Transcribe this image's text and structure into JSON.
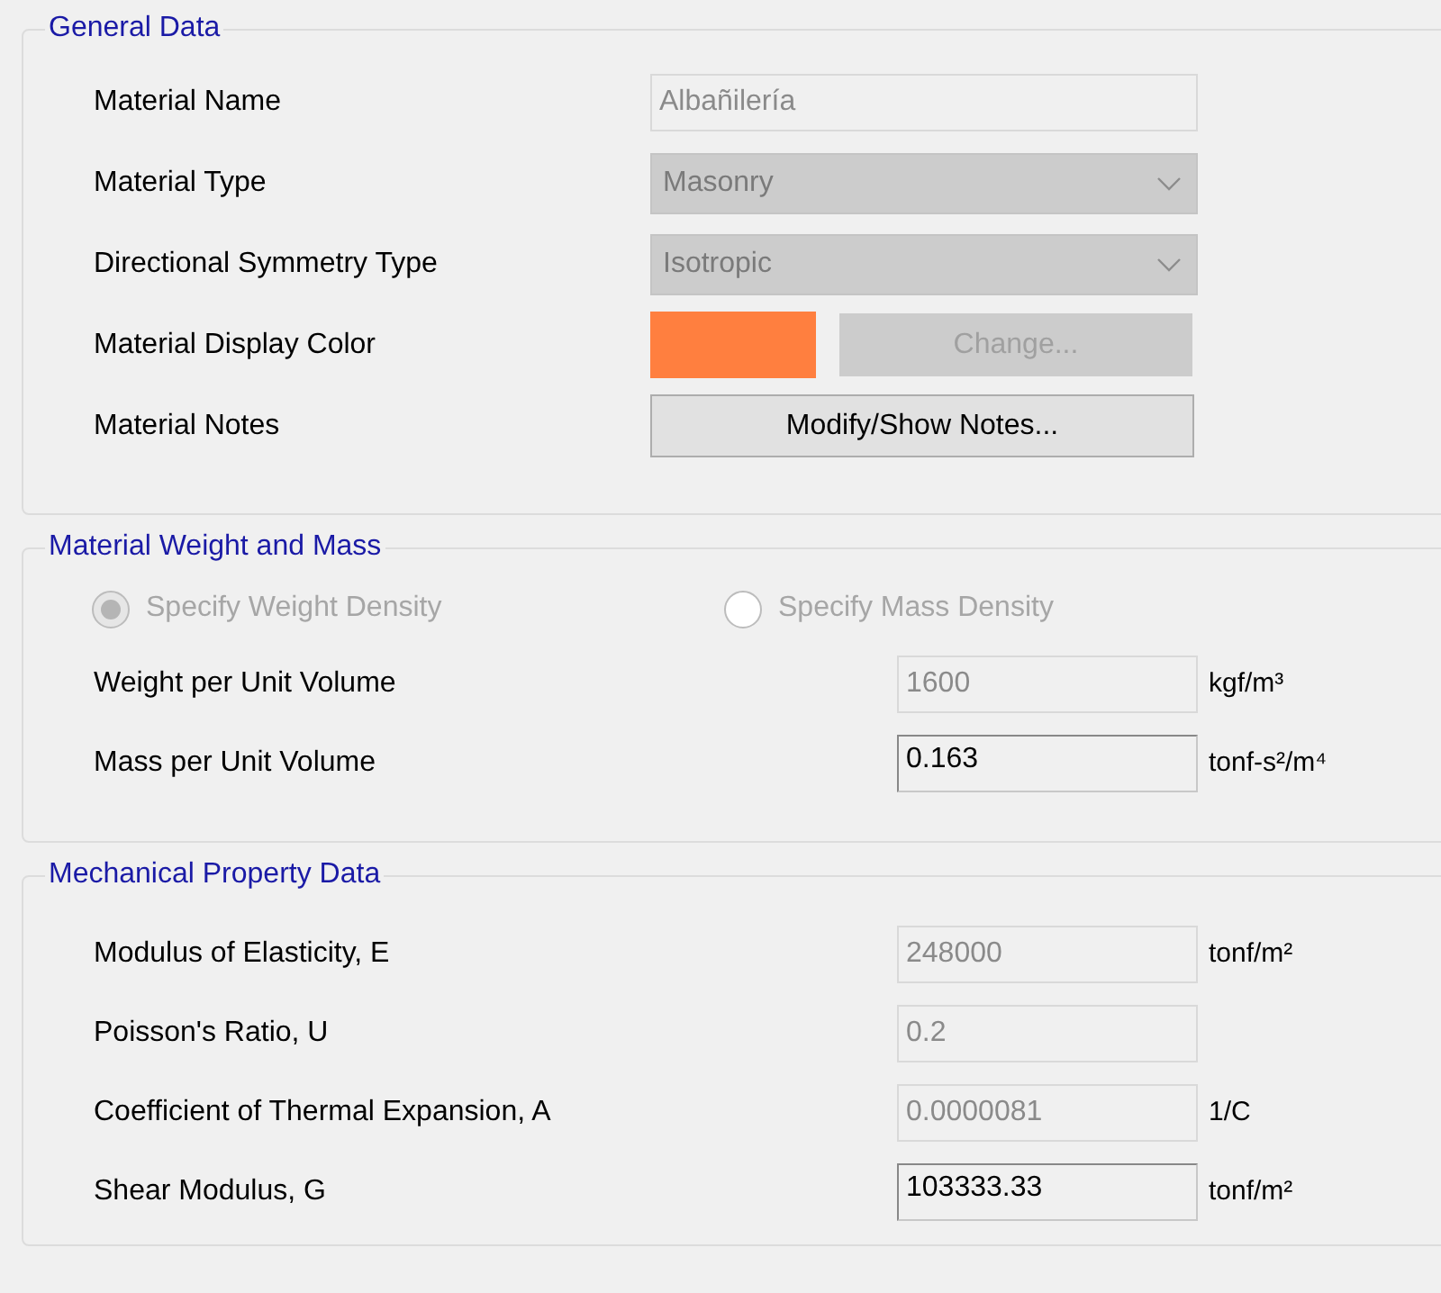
{
  "general_data": {
    "title": "General Data",
    "rows": [
      {
        "kind": "text",
        "label": "Material Name",
        "value": "Albañilería",
        "disabled": true
      },
      {
        "kind": "dropdown",
        "label": "Material Type",
        "value": "Masonry",
        "disabled": true
      },
      {
        "kind": "dropdown",
        "label": "Directional Symmetry Type",
        "value": "Isotropic",
        "disabled": true
      },
      {
        "kind": "color",
        "label": "Material Display Color",
        "color": "#ff7f3f",
        "button": {
          "label": "Change...",
          "disabled": true
        }
      },
      {
        "kind": "button",
        "label": "Material Notes",
        "button": {
          "label": "Modify/Show Notes...",
          "disabled": false
        }
      }
    ]
  },
  "weight_and_mass": {
    "title": "Material Weight and Mass",
    "radios": [
      {
        "label": "Specify Weight Density",
        "selected": true,
        "disabled": true
      },
      {
        "label": "Specify Mass Density",
        "selected": false,
        "disabled": true
      }
    ],
    "rows": [
      {
        "label": "Weight per Unit Volume",
        "value": "1600",
        "unit": "kgf/m³",
        "disabled": true
      },
      {
        "label": "Mass per Unit Volume",
        "value": "0.163",
        "unit": "tonf-s²/m⁴",
        "disabled": false
      }
    ]
  },
  "mechanical_property_data": {
    "title": "Mechanical Property Data",
    "rows": [
      {
        "label": "Modulus of Elasticity,  E",
        "value": "248000",
        "unit": "tonf/m²",
        "disabled": true
      },
      {
        "label": "Poisson's Ratio,  U",
        "value": "0.2",
        "disabled": true
      },
      {
        "label": "Coefficient of Thermal Expansion,  A",
        "value": "0.0000081",
        "unit": "1/C",
        "disabled": true
      },
      {
        "label": "Shear Modulus,  G",
        "value": "103333.33",
        "unit": "tonf/m²",
        "disabled": false
      }
    ]
  }
}
